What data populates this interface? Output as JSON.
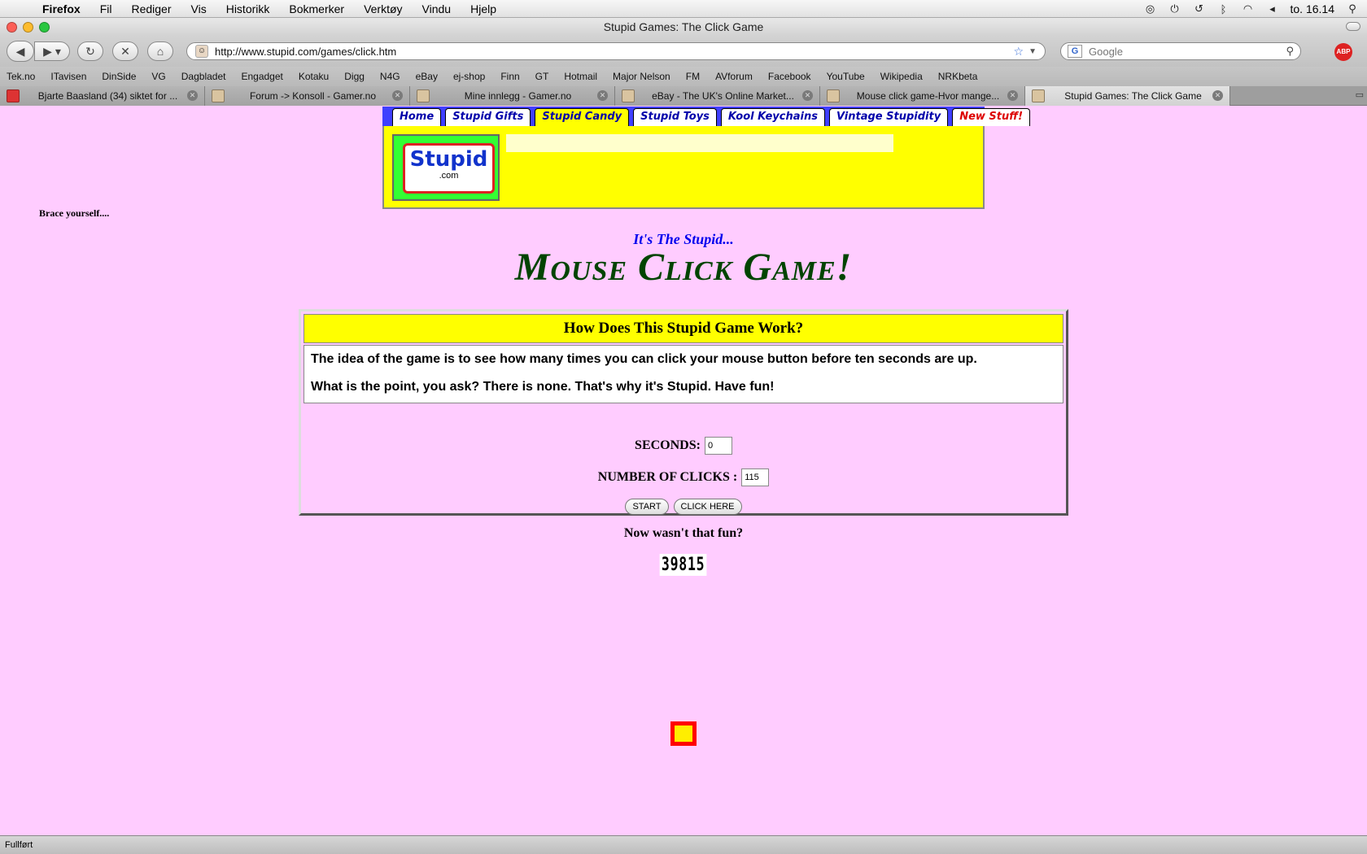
{
  "menubar": {
    "app": "Firefox",
    "items": [
      "Fil",
      "Rediger",
      "Vis",
      "Historikk",
      "Bokmerker",
      "Verktøy",
      "Vindu",
      "Hjelp"
    ],
    "clock": "to. 16.14"
  },
  "window": {
    "title": "Stupid Games: The Click Game"
  },
  "navbar": {
    "url": "http://www.stupid.com/games/click.htm",
    "search_placeholder": "Google",
    "adblock_label": "ABP"
  },
  "bookmarks": [
    "Tek.no",
    "ITavisen",
    "DinSide",
    "VG",
    "Dagbladet",
    "Engadget",
    "Kotaku",
    "Digg",
    "N4G",
    "eBay",
    "ej-shop",
    "Finn",
    "GT",
    "Hotmail",
    "Major Nelson",
    "FM",
    "AVforum",
    "Facebook",
    "YouTube",
    "Wikipedia",
    "NRKbeta"
  ],
  "tabs": [
    {
      "label": "Bjarte Baasland (34) siktet for ..."
    },
    {
      "label": "Forum -> Konsoll - Gamer.no"
    },
    {
      "label": "Mine innlegg - Gamer.no"
    },
    {
      "label": "eBay - The UK's Online Market..."
    },
    {
      "label": "Mouse click game-Hvor mange..."
    },
    {
      "label": "Stupid Games: The Click Game"
    }
  ],
  "store": {
    "tabs": [
      "Home",
      "Stupid Gifts",
      "Stupid Candy",
      "Stupid Toys",
      "Kool Keychains",
      "Vintage Stupidity",
      "New Stuff!"
    ],
    "logo_text": "Stupid",
    "logo_suffix": ".com"
  },
  "page": {
    "aside": "Brace yourself....",
    "subtitle": "It's The Stupid...",
    "title": "Mouse Click Game!"
  },
  "info": {
    "heading": "How Does This Stupid Game Work?",
    "line1": "The idea of the game is to see how many times you can click your mouse button before ten seconds are up.",
    "line2": "What is the point, you ask? There is none. That's why it's Stupid. Have fun!"
  },
  "game": {
    "seconds_label": "SECONDS:",
    "seconds_value": "0",
    "clicks_label": "NUMBER OF CLICKS :",
    "clicks_value": "115",
    "start_label": "START",
    "click_label": "CLICK HERE",
    "result": "Now wasn't that fun?",
    "counter": "39815"
  },
  "status": {
    "text": "Fullført"
  }
}
